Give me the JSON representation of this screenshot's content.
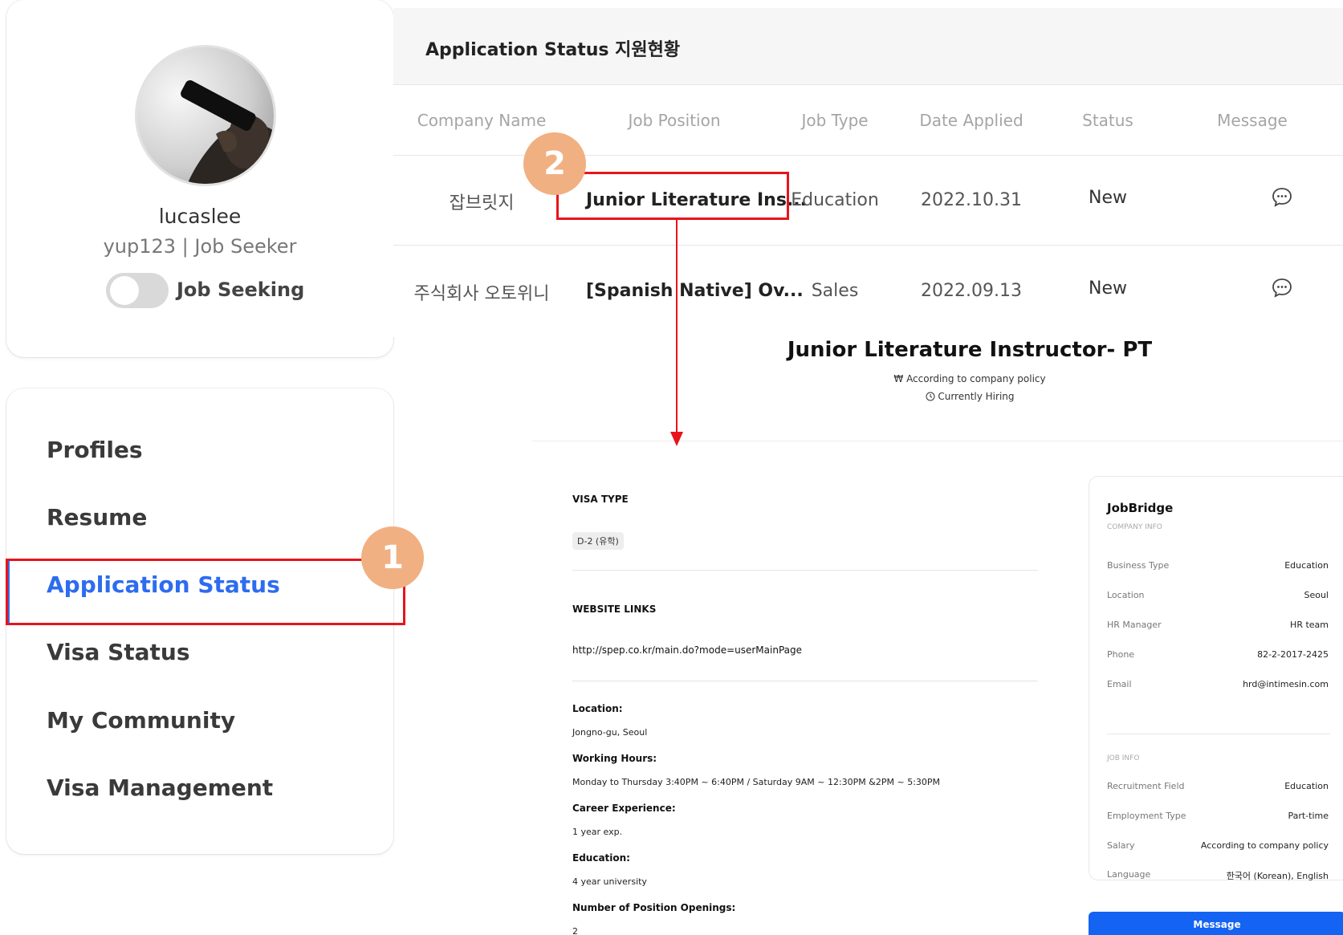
{
  "profile": {
    "username": "lucaslee",
    "userline": "yup123 | Job Seeker",
    "toggle_label": "Job Seeking",
    "toggle_on": false
  },
  "menu": {
    "items": [
      {
        "label": "Profiles"
      },
      {
        "label": "Resume"
      },
      {
        "label": "Application Status",
        "active": true
      },
      {
        "label": "Visa Status"
      },
      {
        "label": "My Community"
      },
      {
        "label": "Visa Management"
      }
    ]
  },
  "application_status": {
    "title": "Application Status 지원현황",
    "columns": [
      "Company Name",
      "Job Position",
      "Job Type",
      "Date Applied",
      "Status",
      "Message"
    ],
    "rows": [
      {
        "company": "잡브릿지",
        "position": "Junior Literature Ins...",
        "job_type": "Education",
        "date": "2022.10.31",
        "status": "New",
        "message_icon": "chat-bubble-icon"
      },
      {
        "company": "주식회사 오토위니",
        "position": "[Spanish Native] Ov...",
        "job_type": "Sales",
        "date": "2022.09.13",
        "status": "New",
        "message_icon": "chat-bubble-icon"
      }
    ]
  },
  "job_detail": {
    "title": "Junior Literature Instructor- PT",
    "salary_icon": "won-icon",
    "salary": "According to company policy",
    "hiring_icon": "clock-icon",
    "hiring": "Currently Hiring",
    "visa_label": "VISA TYPE",
    "visa_value": "D-2 (유학)",
    "links_label": "WEBSITE LINKS",
    "link": "http://spep.co.kr/main.do?mode=userMainPage",
    "details": [
      {
        "key": "Location:",
        "value": "Jongno-gu, Seoul"
      },
      {
        "key": "Working Hours:",
        "value": "Monday to Thursday 3:40PM ~ 6:40PM / Saturday 9AM ~ 12:30PM &2PM ~ 5:30PM"
      },
      {
        "key": "Career Experience:",
        "value": "1 year exp."
      },
      {
        "key": "Education:",
        "value": "4 year university"
      },
      {
        "key": "Number of Position Openings:",
        "value": "2"
      }
    ]
  },
  "company_card": {
    "name": "JobBridge",
    "company_info_label": "COMPANY INFO",
    "company_info": [
      {
        "key": "Business Type",
        "value": "Education"
      },
      {
        "key": "Location",
        "value": "Seoul"
      },
      {
        "key": "HR Manager",
        "value": "HR team"
      },
      {
        "key": "Phone",
        "value": "82-2-2017-2425"
      },
      {
        "key": "Email",
        "value": "hrd@intimesin.com"
      }
    ],
    "job_info_label": "JOB INFO",
    "job_info": [
      {
        "key": "Recruitment Field",
        "value": "Education"
      },
      {
        "key": "Employment Type",
        "value": "Part-time"
      },
      {
        "key": "Salary",
        "value": "According to company policy"
      },
      {
        "key": "Language",
        "value": "한국어 (Korean), English"
      }
    ],
    "message_button": "Message"
  },
  "annotations": {
    "badge_1": "1",
    "badge_2": "2",
    "accent_color": "#e8141b",
    "badge_color": "#f1b082"
  }
}
